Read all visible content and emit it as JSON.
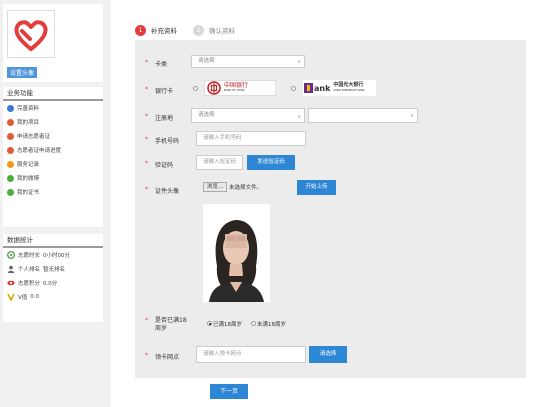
{
  "sidebar": {
    "set_avatar_label": "设置头像",
    "business_title": "业务功能",
    "menu": [
      {
        "label": "完善资料",
        "icon": "edit-icon",
        "color": "#3a78d8"
      },
      {
        "label": "我的项目",
        "icon": "project-icon",
        "color": "#e05a3a"
      },
      {
        "label": "申请志愿者证",
        "icon": "id-card-icon",
        "color": "#e05a3a"
      },
      {
        "label": "志愿者证申请进度",
        "icon": "progress-icon",
        "color": "#e05a3a"
      },
      {
        "label": "服务记录",
        "icon": "record-icon",
        "color": "#f29a1a"
      },
      {
        "label": "我的微博",
        "icon": "weibo-icon",
        "color": "#4caf3a"
      },
      {
        "label": "我的证书",
        "icon": "certificate-icon",
        "color": "#4caf3a"
      }
    ],
    "stats_title": "数据统计",
    "stats": [
      {
        "label": "志愿时长",
        "value": "0小时00分",
        "icon": "clock-icon"
      },
      {
        "label": "个人排名",
        "value": "暂无排名",
        "icon": "person-icon"
      },
      {
        "label": "志愿积分",
        "value": "0.0分",
        "icon": "eye-icon"
      },
      {
        "label": "V值",
        "value": "0.0",
        "icon": "v-icon"
      }
    ]
  },
  "steps": [
    {
      "num": "1",
      "label": "补充资料",
      "active": true
    },
    {
      "num": "2",
      "label": "确认资料",
      "active": false
    }
  ],
  "form": {
    "required_mark": "*",
    "card_type": {
      "label": "卡类",
      "placeholder": "请选择"
    },
    "bank_card": {
      "label": "银行卡",
      "banks": [
        {
          "name": "中国银行",
          "subname": "BANK OF CHINA"
        },
        {
          "name": "中国光大银行",
          "subname": "CHINA EVERBRIGHT BANK",
          "logo_text": "ank"
        }
      ]
    },
    "registration_place": {
      "label": "注册地",
      "placeholder": "请选择"
    },
    "phone": {
      "label": "手机号码",
      "placeholder": "请输入手机号码"
    },
    "verify_code": {
      "label": "验证码",
      "placeholder": "请输入验证码",
      "send_button": "发送验证码"
    },
    "id_photo": {
      "label": "证件头像",
      "browse_button": "浏览...",
      "no_file_text": "未选择文件。",
      "upload_button": "开始上传"
    },
    "age_check": {
      "label": "是否已满18周岁",
      "options": [
        "已满18周岁",
        "未满18周岁"
      ],
      "selected": "已满18周岁"
    },
    "pickup_point": {
      "label": "领卡网点",
      "placeholder": "请输入领卡网点",
      "select_button": "请选择"
    },
    "next_button": "下一页"
  }
}
